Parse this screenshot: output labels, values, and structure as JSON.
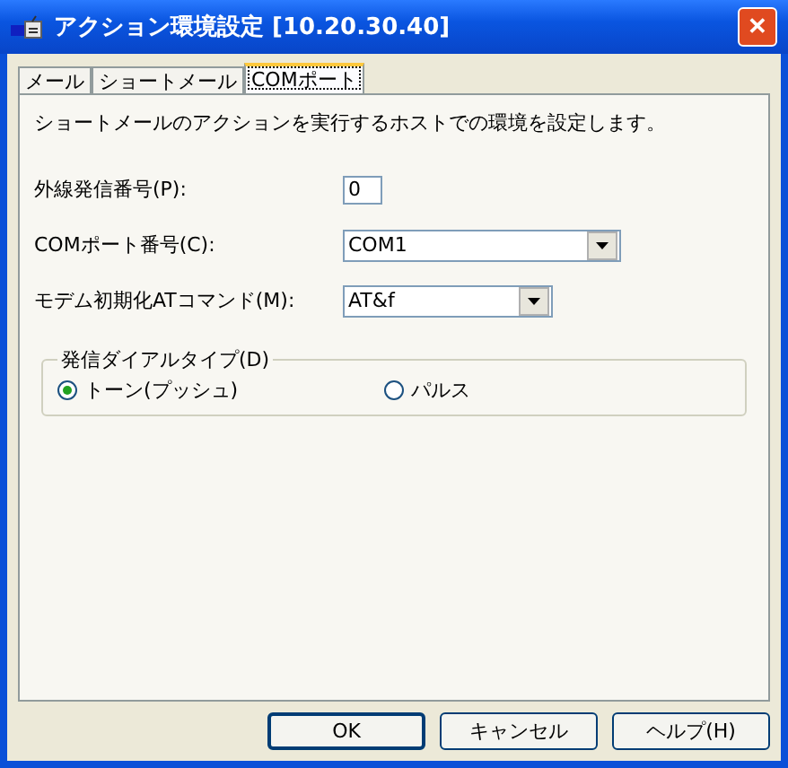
{
  "window": {
    "title": "アクション環境設定 [10.20.30.40]",
    "close": "✕"
  },
  "tabs": [
    {
      "label": "メール",
      "selected": false
    },
    {
      "label": "ショートメール",
      "selected": false
    },
    {
      "label": "COMポート",
      "selected": true
    }
  ],
  "description": "ショートメールのアクションを実行するホストでの環境を設定します。",
  "fields": [
    {
      "kind": "text",
      "label": "外線発信番号(P):",
      "value": "0"
    },
    {
      "kind": "combo",
      "label": "COMポート番号(C):",
      "value": "COM1"
    },
    {
      "kind": "combo",
      "label": "モデム初期化ATコマンド(M):",
      "value": "AT&f"
    }
  ],
  "dial_group": {
    "legend": "発信ダイアルタイプ(D)",
    "options": [
      {
        "label": "トーン(プッシュ)",
        "selected": true
      },
      {
        "label": "パルス",
        "selected": false
      }
    ]
  },
  "buttons": [
    {
      "label": "OK",
      "default": true
    },
    {
      "label": "キャンセル",
      "default": false
    },
    {
      "label": "ヘルプ(H)",
      "default": false
    }
  ]
}
